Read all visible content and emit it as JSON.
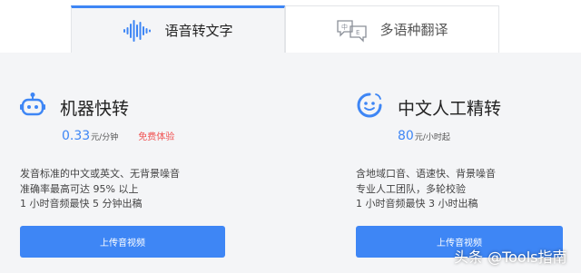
{
  "tabs": [
    {
      "label": "语音转文字",
      "icon": "waveform-icon",
      "active": true
    },
    {
      "label": "多语种翻译",
      "icon": "translate-icon",
      "active": false
    }
  ],
  "cards": [
    {
      "title": "机器快转",
      "icon": "robot-icon",
      "price": "0.33",
      "unit": "元/分钟",
      "badge": "免费体验",
      "desc": [
        "发音标准的中文或英文、无背景噪音",
        "准确率最高可达 95% 以上",
        "1 小时音频最快 5 分钟出稿"
      ],
      "button": "上传音视频"
    },
    {
      "title": "中文人工精转",
      "icon": "human-transcribe-icon",
      "price": "80",
      "unit": "元/小时起",
      "desc": [
        "含地域口音、语速快、背景噪音",
        "专业人工团队，多轮校验",
        "1 小时音频最快 3 小时出稿"
      ],
      "button": "上传音视频"
    }
  ],
  "watermark": "头条 @Tools指南",
  "colors": {
    "accent": "#3e86f5",
    "badge": "#f05252",
    "background": "#f4f5f7"
  }
}
